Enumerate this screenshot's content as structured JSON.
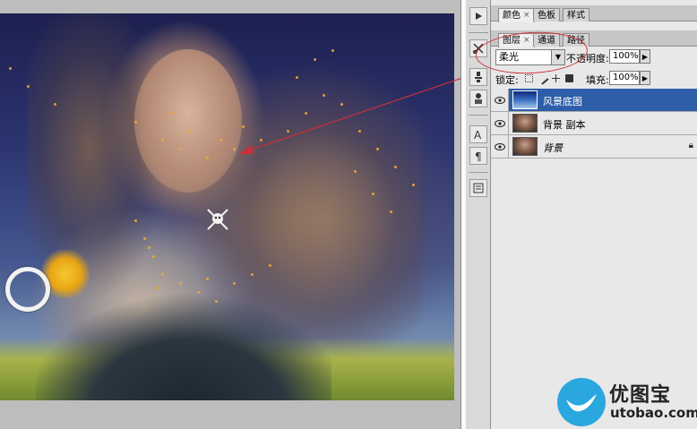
{
  "panel_tabs_top": [
    {
      "label": "颜色",
      "closable": true,
      "active": true
    },
    {
      "label": "色板",
      "closable": false,
      "active": false
    },
    {
      "label": "样式",
      "closable": false,
      "active": false
    }
  ],
  "layers_tabs": [
    {
      "label": "图层",
      "closable": true,
      "active": true
    },
    {
      "label": "通道",
      "closable": false,
      "active": false
    },
    {
      "label": "路径",
      "closable": false,
      "active": false
    }
  ],
  "layers_panel": {
    "blend_mode": "柔光",
    "opacity_label": "不透明度:",
    "opacity_value": "100%",
    "lock_label": "锁定:",
    "fill_label": "填充:",
    "fill_value": "100%"
  },
  "layers": [
    {
      "name": "风景底图",
      "selected": true,
      "visible": true
    },
    {
      "name": "背景 副本",
      "selected": false,
      "visible": true
    },
    {
      "name": "背景",
      "selected": false,
      "visible": true,
      "locked": true
    }
  ],
  "watermark": {
    "brand": "优图宝",
    "site": "utobao.com"
  },
  "colors": {
    "selection_blue": "#2e5ea8",
    "annotation_red": "#d0353a",
    "watermark_blue": "#2aa7df"
  }
}
